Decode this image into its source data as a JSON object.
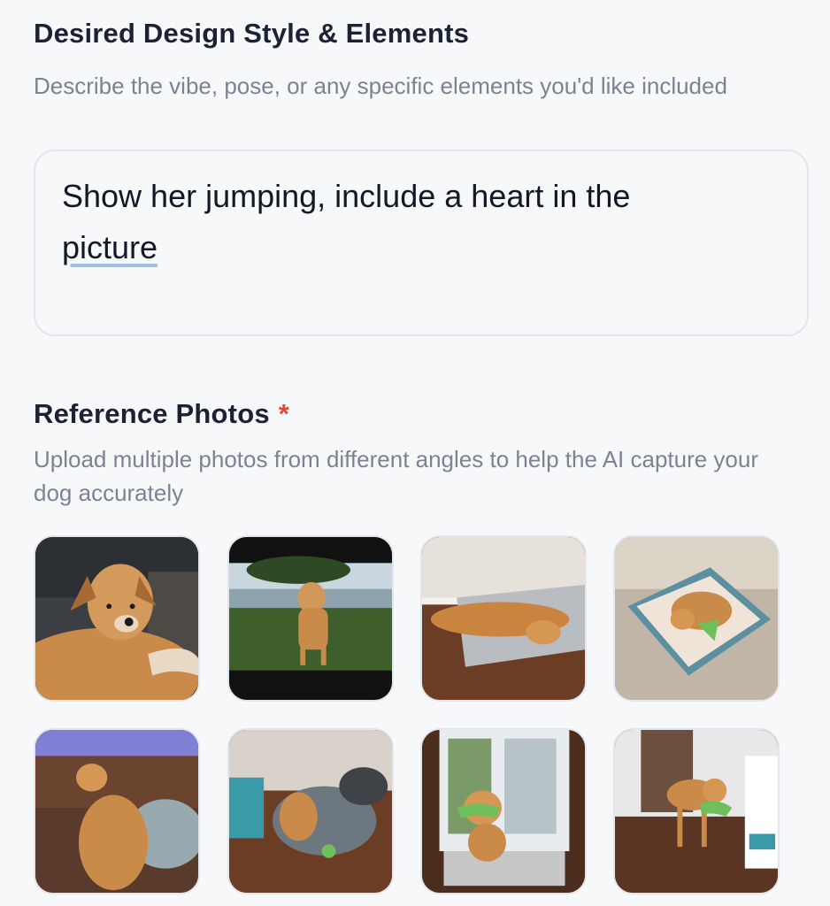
{
  "design_style": {
    "title": "Desired Design Style & Elements",
    "description": "Describe the vibe, pose, or any specific elements you'd like included",
    "input_value_part1": "Show her jumping, include a heart in the",
    "input_value_part2": "picture"
  },
  "reference_photos": {
    "title": "Reference Photos",
    "required_marker": "*",
    "description": "Upload multiple photos from different angles to help the AI capture your dog accurately"
  }
}
